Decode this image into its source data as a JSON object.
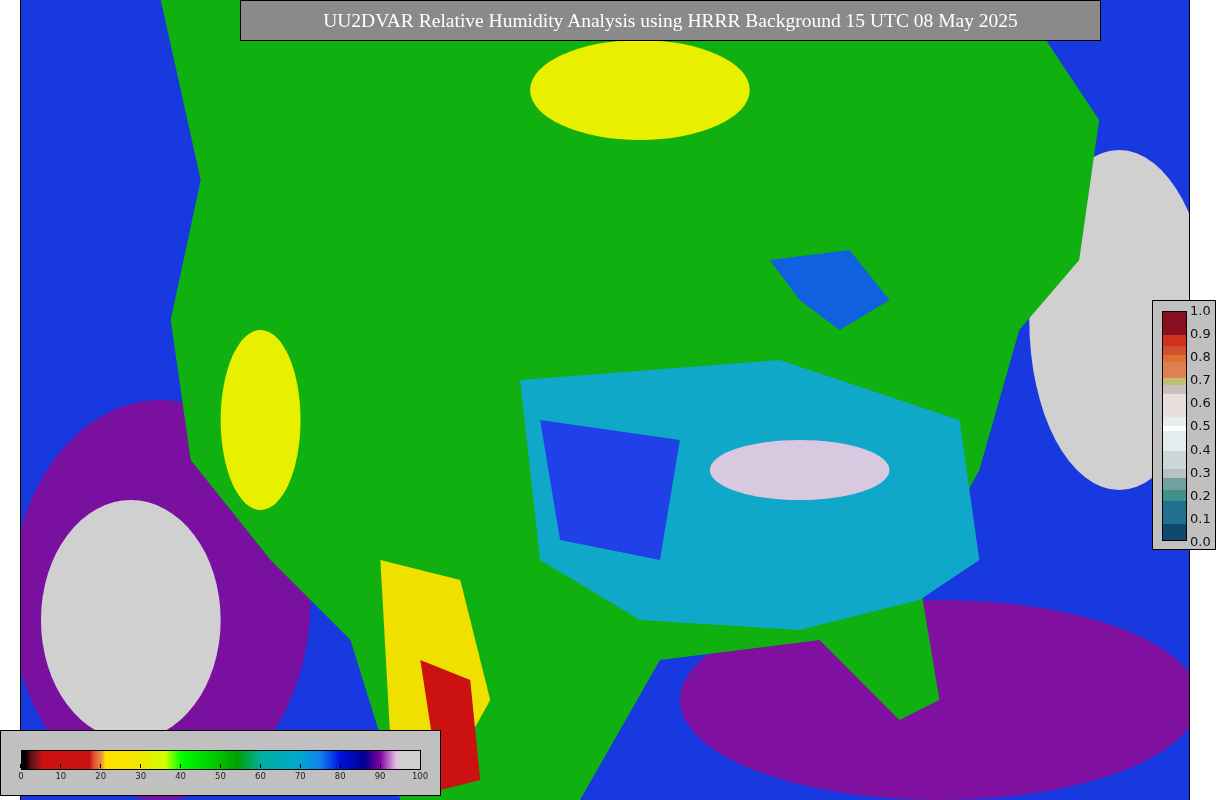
{
  "title": "UU2DVAR Relative Humidity Analysis using HRRR Background 15 UTC 08 May 2025",
  "colorbar": {
    "ticks": [
      "0",
      "10",
      "20",
      "30",
      "40",
      "50",
      "60",
      "70",
      "80",
      "90",
      "100"
    ]
  },
  "legend": {
    "ticks": [
      "1.0",
      "0.9",
      "0.8",
      "0.7",
      "0.6",
      "0.5",
      "0.4",
      "0.3",
      "0.2",
      "0.1",
      "0.0"
    ]
  }
}
